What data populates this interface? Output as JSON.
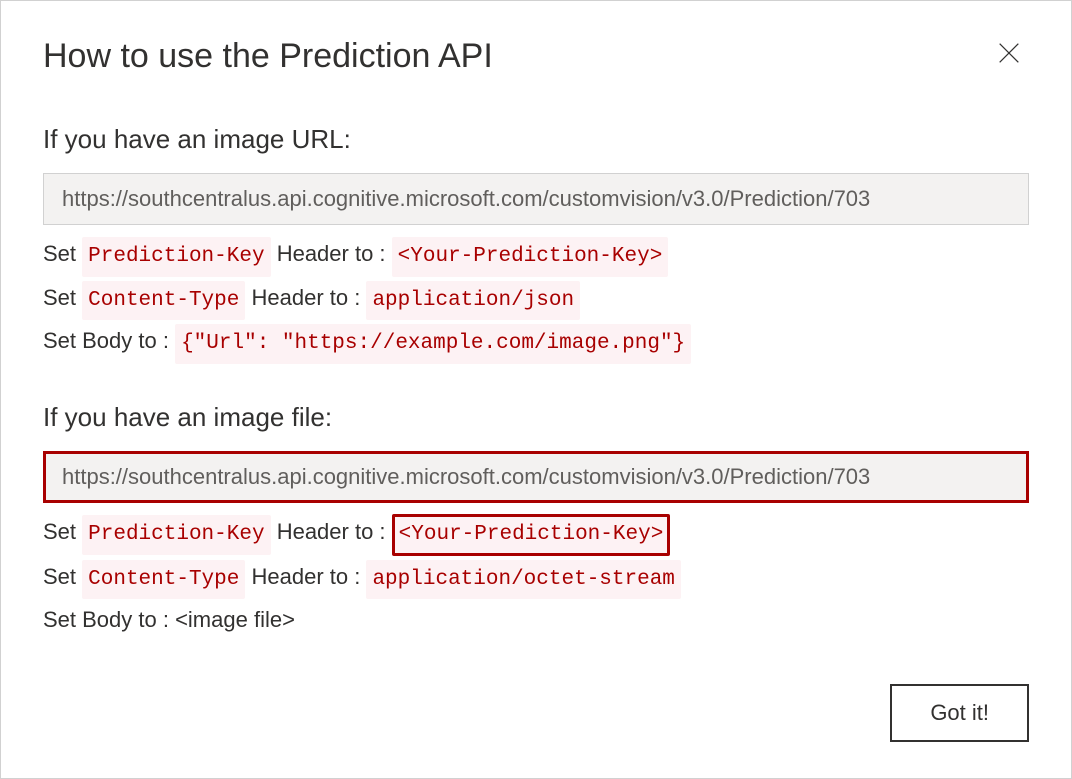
{
  "dialog": {
    "title": "How to use the Prediction API"
  },
  "section_url": {
    "title": "If you have an image URL:",
    "url": "https://southcentralus.api.cognitive.microsoft.com/customvision/v3.0/Prediction/703",
    "line1_prefix": "Set ",
    "line1_code1": "Prediction-Key",
    "line1_mid": " Header to : ",
    "line1_code2": "<Your-Prediction-Key>",
    "line2_prefix": "Set ",
    "line2_code1": "Content-Type",
    "line2_mid": " Header to : ",
    "line2_code2": "application/json",
    "line3_prefix": "Set Body to : ",
    "line3_code1": "{\"Url\": \"https://example.com/image.png\"}"
  },
  "section_file": {
    "title": "If you have an image file:",
    "url": "https://southcentralus.api.cognitive.microsoft.com/customvision/v3.0/Prediction/703",
    "line1_prefix": "Set ",
    "line1_code1": "Prediction-Key",
    "line1_mid": " Header to : ",
    "line1_code2": "<Your-Prediction-Key>",
    "line2_prefix": "Set ",
    "line2_code1": "Content-Type",
    "line2_mid": " Header to : ",
    "line2_code2": "application/octet-stream",
    "line3_text": "Set Body to : <image file>"
  },
  "footer": {
    "got_it_label": "Got it!"
  }
}
